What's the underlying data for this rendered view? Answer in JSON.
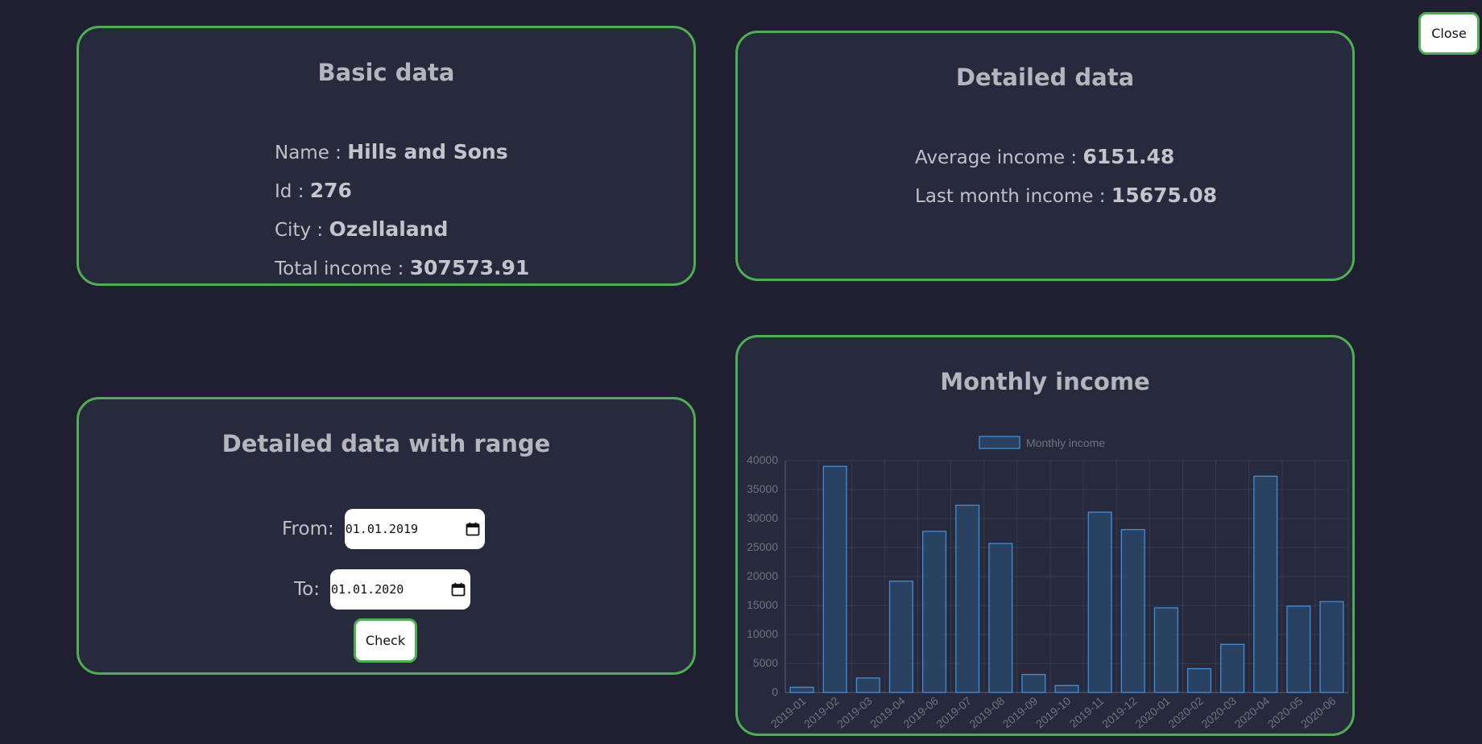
{
  "close_label": "Close",
  "basic": {
    "title": "Basic data",
    "name_label": "Name : ",
    "name_value": "Hills and Sons",
    "id_label": "Id : ",
    "id_value": "276",
    "city_label": "City : ",
    "city_value": "Ozellaland",
    "total_label": "Total income : ",
    "total_value": "307573.91"
  },
  "detailed": {
    "title": "Detailed data",
    "avg_label": "Average income : ",
    "avg_value": "6151.48",
    "last_label": "Last month income : ",
    "last_value": "15675.08"
  },
  "range": {
    "title": "Detailed data with range",
    "from_label": "From:",
    "from_value": "01.01.2019",
    "to_label": "To:",
    "to_value": "01.01.2020",
    "check_label": "Check"
  },
  "colors": {
    "background": "#1f1f31",
    "card": "#272a3d",
    "border": "#4caf50",
    "bar_fill": "#2c4768",
    "bar_stroke": "#3e8ede"
  },
  "chart_data": {
    "type": "bar",
    "title": "Monthly income",
    "legend": "top",
    "grid": true,
    "ylim": [
      0,
      40000
    ],
    "yticks": [
      0,
      5000,
      10000,
      15000,
      20000,
      25000,
      30000,
      35000,
      40000
    ],
    "categories": [
      "2019-01",
      "2019-02",
      "2019-03",
      "2019-04",
      "2019-06",
      "2019-07",
      "2019-08",
      "2019-09",
      "2019-10",
      "2019-11",
      "2019-12",
      "2020-01",
      "2020-02",
      "2020-03",
      "2020-04",
      "2020-05",
      "2020-06"
    ],
    "series": [
      {
        "name": "Monthly income",
        "values": [
          900,
          39000,
          2500,
          19200,
          27800,
          32300,
          25700,
          3100,
          1200,
          31100,
          28100,
          14600,
          4100,
          8300,
          37300,
          14900,
          15675.08
        ]
      }
    ]
  }
}
